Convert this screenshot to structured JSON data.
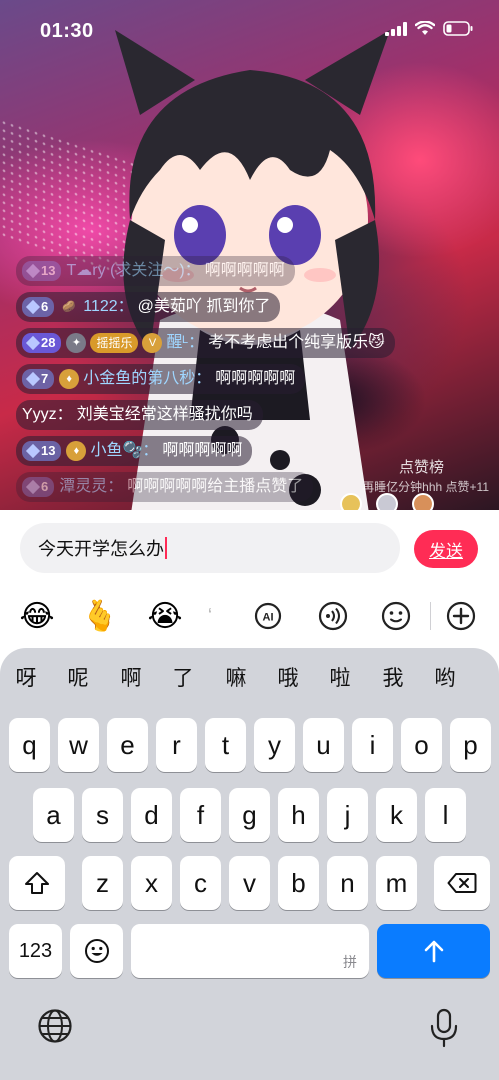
{
  "status_bar": {
    "time": "01:30"
  },
  "chat": {
    "messages": [
      {
        "level": "13",
        "name": "T☁ry (求关注～)：",
        "text": "啊啊啊啊啊",
        "faded": true
      },
      {
        "level": "6",
        "name": "1122：",
        "text": "@美茹吖 抓到你了",
        "badge": "🥔"
      },
      {
        "level": "28",
        "badge_pill": "摇摇乐",
        "name": "醒ᴸ：",
        "text": "考不考虑出个纯享版乐😼"
      },
      {
        "level": "7",
        "name": "小金鱼的第八秒：",
        "text": "啊啊啊啊啊"
      },
      {
        "name": "Yyyz：",
        "text": "刘美宝经常这样骚扰你吗",
        "plain": true
      },
      {
        "level": "13",
        "name": "小鱼🫧：",
        "text": "啊啊啊啊啊"
      },
      {
        "level": "6",
        "name": "潭灵灵：",
        "text": "啊啊啊啊啊",
        "faded": true
      }
    ],
    "rank_label": "点赞榜",
    "like_hint": "再睡亿分钟hhh 点赞+11",
    "trailing_hint": "给主播点赞了"
  },
  "composer": {
    "input_value": "今天开学怎么办",
    "send_label": "发送"
  },
  "toolbar": {
    "items": [
      "😂",
      "🫰",
      "😭"
    ]
  },
  "keyboard": {
    "candidates": [
      "呀",
      "呢",
      "啊",
      "了",
      "嘛",
      "哦",
      "啦",
      "我",
      "哟"
    ],
    "row1": [
      "q",
      "w",
      "e",
      "r",
      "t",
      "y",
      "u",
      "i",
      "o",
      "p"
    ],
    "row2": [
      "a",
      "s",
      "d",
      "f",
      "g",
      "h",
      "j",
      "k",
      "l"
    ],
    "row3": [
      "z",
      "x",
      "c",
      "v",
      "b",
      "n",
      "m"
    ],
    "numbers_label": "123",
    "space_hint": "拼"
  },
  "colors": {
    "accent": "#ff2c55",
    "return_key": "#0a7cff",
    "keyboard_bg": "#d2d4da"
  }
}
